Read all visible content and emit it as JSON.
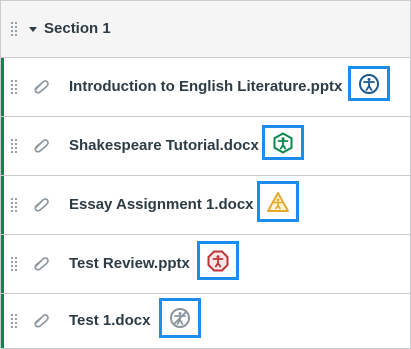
{
  "section": {
    "title": "Section 1"
  },
  "items": [
    {
      "title": "Introduction to English Literature.pptx",
      "icon": "accessibility-circle-icon",
      "color": "#1d5a8f"
    },
    {
      "title": "Shakespeare Tutorial.docx",
      "icon": "accessibility-hexagon-icon",
      "color": "#0b874b"
    },
    {
      "title": "Essay Assignment 1.docx",
      "icon": "accessibility-warning-triangle-icon",
      "color": "#e5a82a"
    },
    {
      "title": "Test Review.pptx",
      "icon": "accessibility-octagon-icon",
      "color": "#c0323a"
    },
    {
      "title": "Test 1.docx",
      "icon": "accessibility-unavailable-icon",
      "color": "#8b969e"
    }
  ],
  "colors": {
    "accent_bar": "#0b874b",
    "highlight_border": "#1d8ded",
    "text": "#2d3b45"
  }
}
